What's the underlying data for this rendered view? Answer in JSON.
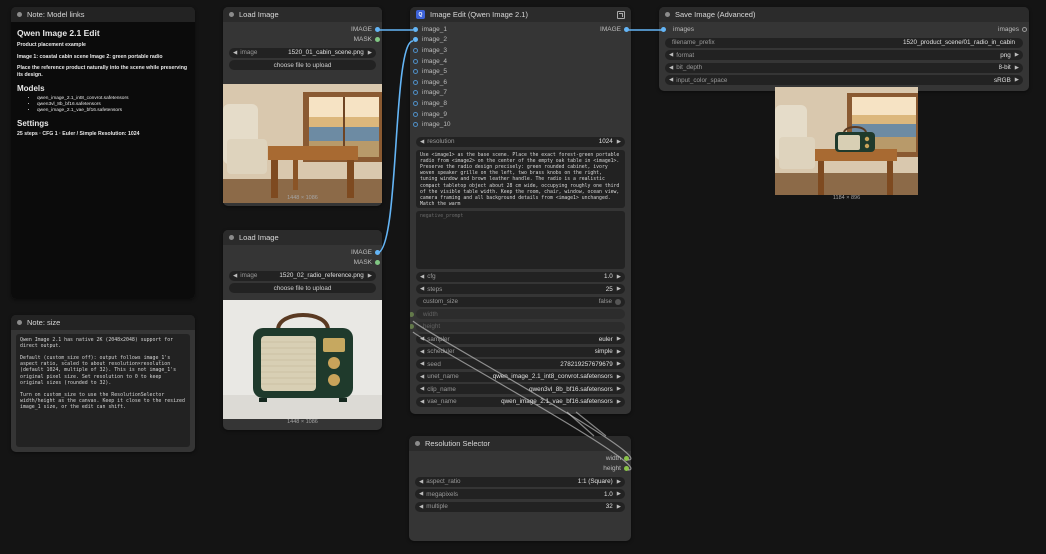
{
  "notes": {
    "model_links": {
      "title": "Note: Model links",
      "heading": "Qwen Image 2.1 Edit",
      "subtitle": "Product placement example",
      "line1": "Image 1: coastal cabin scene Image 2: green portable radio",
      "line2": "Place the reference product naturally into the scene while preserving its design.",
      "models_heading": "Models",
      "models": [
        "qwen_image_2.1_int8_convrot.safetensors",
        "qwen3vl_8b_bf16.safetensors",
        "qwen_image_2.1_vae_bf16.safetensors"
      ],
      "settings_heading": "Settings",
      "settings_text": "25 steps · CFG 1 · Euler / Simple Resolution: 1024"
    },
    "size": {
      "title": "Note: size",
      "text": "Qwen Image 2.1 has native 2K (2048x2048) support for direct output.\n\nDefault (custom_size off): output follows image_1's aspect ratio, scaled to about resolution×resolution (default 1024, multiple of 32). This is not image_1's original pixel size. Set resolution to 0 to keep original sizes (rounded to 32).\n\nTurn on custom_size to use the ResolutionSelector width/height as the canvas. Keep it close to the resized image_1 size, or the edit can shift."
    }
  },
  "load_image_1": {
    "title": "Load Image",
    "outputs": [
      "IMAGE",
      "MASK"
    ],
    "image_label": "image",
    "image_value": "1520_01_cabin_scene.png",
    "upload_label": "choose file to upload",
    "preview_size": "1448 × 1086"
  },
  "load_image_2": {
    "title": "Load Image",
    "outputs": [
      "IMAGE",
      "MASK"
    ],
    "image_label": "image",
    "image_value": "1520_02_radio_reference.png",
    "upload_label": "choose file to upload",
    "preview_size": "1448 × 1086"
  },
  "image_edit": {
    "title": "Image Edit (Qwen Image 2.1)",
    "badge": "Q",
    "output": "IMAGE",
    "inputs": [
      "image_1",
      "image_2",
      "image_3",
      "image_4",
      "image_5",
      "image_6",
      "image_7",
      "image_8",
      "image_9",
      "image_10"
    ],
    "resolution_label": "resolution",
    "resolution_value": "1024",
    "prompt": "Use <image1> as the base scene. Place the exact forest-green portable radio from <image2> on the center of the empty oak table in <image1>. Preserve the radio design precisely: green rounded cabinet, ivory woven speaker grille on the left, two brass knobs on the right, tuning window and brown leather handle. The radio is a realistic compact tabletop object about 28 cm wide, occupying roughly one third of the visible table width. Keep the room, chair, window, ocean view, camera framing and all background details from <image1> unchanged. Match the warm",
    "negative_placeholder": "negative_prompt",
    "widgets": [
      {
        "label": "cfg",
        "value": "1.0"
      },
      {
        "label": "steps",
        "value": "25"
      }
    ],
    "custom_size_label": "custom_size",
    "custom_size_value": "false",
    "width_label": "width",
    "height_label": "height",
    "widgets2": [
      {
        "label": "sampler",
        "value": "euler"
      },
      {
        "label": "scheduler",
        "value": "simple"
      },
      {
        "label": "seed",
        "value": "278219257679679"
      },
      {
        "label": "unet_name",
        "value": "qwen_image_2.1_int8_convrot.safetensors"
      },
      {
        "label": "clip_name",
        "value": "qwen3vl_8b_bf16.safetensors"
      },
      {
        "label": "vae_name",
        "value": "qwen_image_2.1_vae_bf16.safetensors"
      }
    ]
  },
  "save_image": {
    "title": "Save Image (Advanced)",
    "input": "images",
    "output": "images",
    "widgets": [
      {
        "label": "filename_prefix",
        "value": "1520_product_scene/01_radio_in_cabin"
      },
      {
        "label": "format",
        "value": "png"
      },
      {
        "label": "bit_depth",
        "value": "8-bit"
      },
      {
        "label": "input_color_space",
        "value": "sRGB"
      }
    ],
    "preview_size": "1184 × 896"
  },
  "resolution_selector": {
    "title": "Resolution Selector",
    "outputs": [
      "width",
      "height"
    ],
    "widgets": [
      {
        "label": "aspect_ratio",
        "value": "1:1 (Square)"
      },
      {
        "label": "megapixels",
        "value": "1.0"
      },
      {
        "label": "multiple",
        "value": "32"
      }
    ]
  },
  "colors": {
    "canvas": "#141414",
    "node": "#353535",
    "image_wire": "#64b5f6",
    "int_wire": "#9ccc65"
  }
}
